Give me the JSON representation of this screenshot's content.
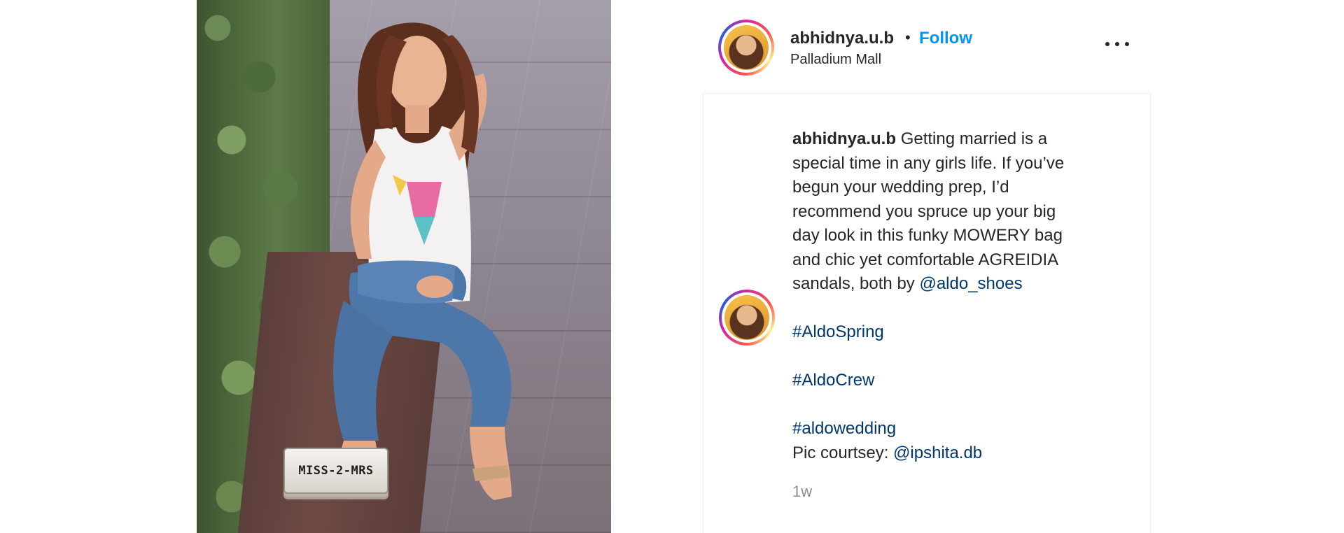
{
  "post": {
    "username": "abhidnya.u.b",
    "dot": "•",
    "follow_label": "Follow",
    "location": "Palladium Mall",
    "caption": {
      "text_lines": [
        "Getting married is a",
        "special time in any girls life. If you’ve",
        "begun your wedding prep, I’d",
        "recommend you spruce up your big",
        "day look in this funky MOWERY bag",
        "and chic yet comfortable AGREIDIA",
        "sandals, both by "
      ],
      "brand_mention": "@aldo_shoes",
      "hashtags": [
        "#AldoSpring",
        "#AldoCrew",
        "#aldowedding"
      ],
      "credit_prefix": "Pic courtsey: ",
      "credit_mention": "@ipshita.db"
    },
    "time_ago": "1w",
    "plate_text": "MISS-2-MRS"
  },
  "colors": {
    "follow_blue": "#0095f6",
    "link_navy": "#00376b",
    "text": "#262626",
    "muted": "#8e8e8e"
  },
  "icons": {
    "more": "more-options-icon"
  }
}
